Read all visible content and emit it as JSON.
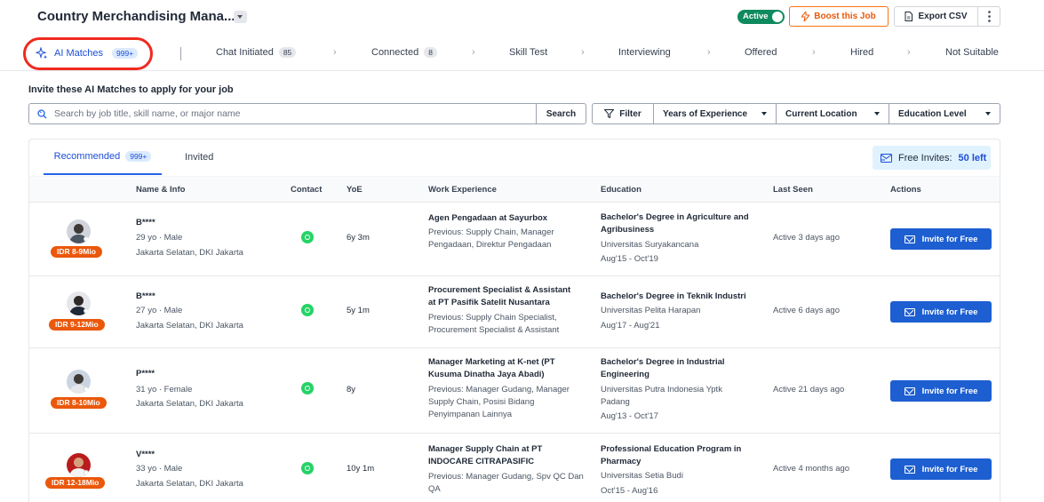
{
  "header": {
    "job_title": "Country Merchandising Mana...",
    "status_toggle": "Active",
    "boost_label": "Boost this Job",
    "export_label": "Export CSV"
  },
  "pipeline": {
    "ai_matches": {
      "label": "AI Matches",
      "count": "999+"
    },
    "stages": [
      {
        "label": "Chat Initiated",
        "count": "85"
      },
      {
        "label": "Connected",
        "count": "8"
      },
      {
        "label": "Skill Test"
      },
      {
        "label": "Interviewing"
      },
      {
        "label": "Offered"
      },
      {
        "label": "Hired"
      },
      {
        "label": "Not Suitable"
      }
    ]
  },
  "invite_section": {
    "title": "Invite these AI Matches to apply for your job",
    "search_placeholder": "Search by job title, skill name, or major name",
    "search_button": "Search",
    "filter_button": "Filter",
    "dropdowns": [
      "Years of Experience",
      "Current Location",
      "Education Level"
    ]
  },
  "tabs": {
    "recommended": {
      "label": "Recommended",
      "count": "999+"
    },
    "invited": {
      "label": "Invited"
    }
  },
  "free_invites": {
    "label": "Free Invites:",
    "value": "50 left"
  },
  "table": {
    "columns": [
      "Name & Info",
      "Contact",
      "YoE",
      "Work Experience",
      "Education",
      "Last Seen",
      "Actions"
    ],
    "invite_label": "Invite for Free",
    "rows": [
      {
        "salary": "IDR 8-9Mio",
        "name": "B****",
        "age_gender": "29 yo · Male",
        "location": "Jakarta Selatan, DKI Jakarta",
        "yoe": "6y 3m",
        "job_title": "Agen Pengadaan at Sayurbox",
        "previous": "Previous: Supply Chain, Manager Pengadaan, Direktur Pengadaan",
        "degree": "Bachelor's Degree in Agriculture and Agribusiness",
        "school": "Universitas Suryakancana",
        "period": "Aug'15 - Oct'19",
        "last_seen": "Active 3 days ago"
      },
      {
        "salary": "IDR 9-12Mio",
        "name": "B****",
        "age_gender": "27 yo · Male",
        "location": "Jakarta Selatan, DKI Jakarta",
        "yoe": "5y 1m",
        "job_title": "Procurement Specialist & Assistant at PT Pasifik Satelit Nusantara",
        "previous": "Previous: Supply Chain Specialist, Procurement Specialist & Assistant",
        "degree": "Bachelor's Degree in Teknik Industri",
        "school": "Universitas Pelita Harapan",
        "period": "Aug'17 - Aug'21",
        "last_seen": "Active 6 days ago"
      },
      {
        "salary": "IDR 8-10Mio",
        "name": "P****",
        "age_gender": "31 yo · Female",
        "location": "Jakarta Selatan, DKI Jakarta",
        "yoe": "8y",
        "job_title": "Manager Marketing at K-net (PT Kusuma Dinatha Jaya Abadi)",
        "previous": "Previous: Manager Gudang, Manager Supply Chain, Posisi Bidang Penyimpanan Lainnya",
        "degree": "Bachelor's Degree in Industrial Engineering",
        "school": "Universitas Putra Indonesia Yptk Padang",
        "period": "Aug'13 - Oct'17",
        "last_seen": "Active 21 days ago"
      },
      {
        "salary": "IDR 12-18Mio",
        "name": "V****",
        "age_gender": "33 yo · Male",
        "location": "Jakarta Selatan, DKI Jakarta",
        "yoe": "10y 1m",
        "job_title": "Manager Supply Chain at PT INDOCARE CITRAPASIFIC",
        "previous": "Previous: Manager Gudang, Spv QC Dan QA",
        "degree": "Professional Education Program in Pharmacy",
        "school": "Universitas Setia Budi",
        "period": "Oct'15 - Aug'16",
        "last_seen": "Active 4 months ago"
      }
    ]
  }
}
